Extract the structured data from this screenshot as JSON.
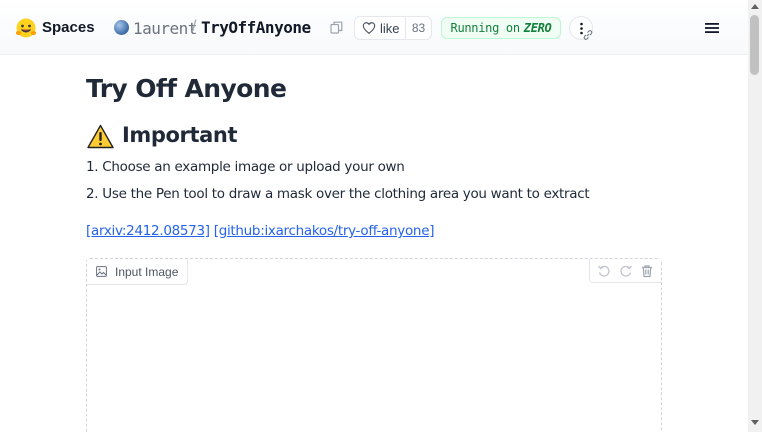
{
  "header": {
    "brand": "Spaces",
    "owner": "1aurent",
    "separator": "/",
    "repo_name": "TryOffAnyone",
    "like_label": "like",
    "like_count": "83",
    "status_prefix": "Running on",
    "status_hardware": "ZERO",
    "colors": {
      "status_text": "#15803d",
      "status_bg": "#f0fdf4"
    }
  },
  "main": {
    "title": "Try Off Anyone",
    "important_heading": "Important",
    "steps": [
      "1. Choose an example image or upload your own",
      "2. Use the Pen tool to draw a mask over the clothing area you want to extract"
    ],
    "links": [
      {
        "label": "[arxiv:2412.08573]"
      },
      {
        "label": "[github:ixarchakos/try-off-anyone]"
      }
    ],
    "link_color": "#2563eb"
  },
  "editor": {
    "label": "Input Image",
    "tools": [
      "undo-icon",
      "redo-icon",
      "trash-icon"
    ]
  }
}
